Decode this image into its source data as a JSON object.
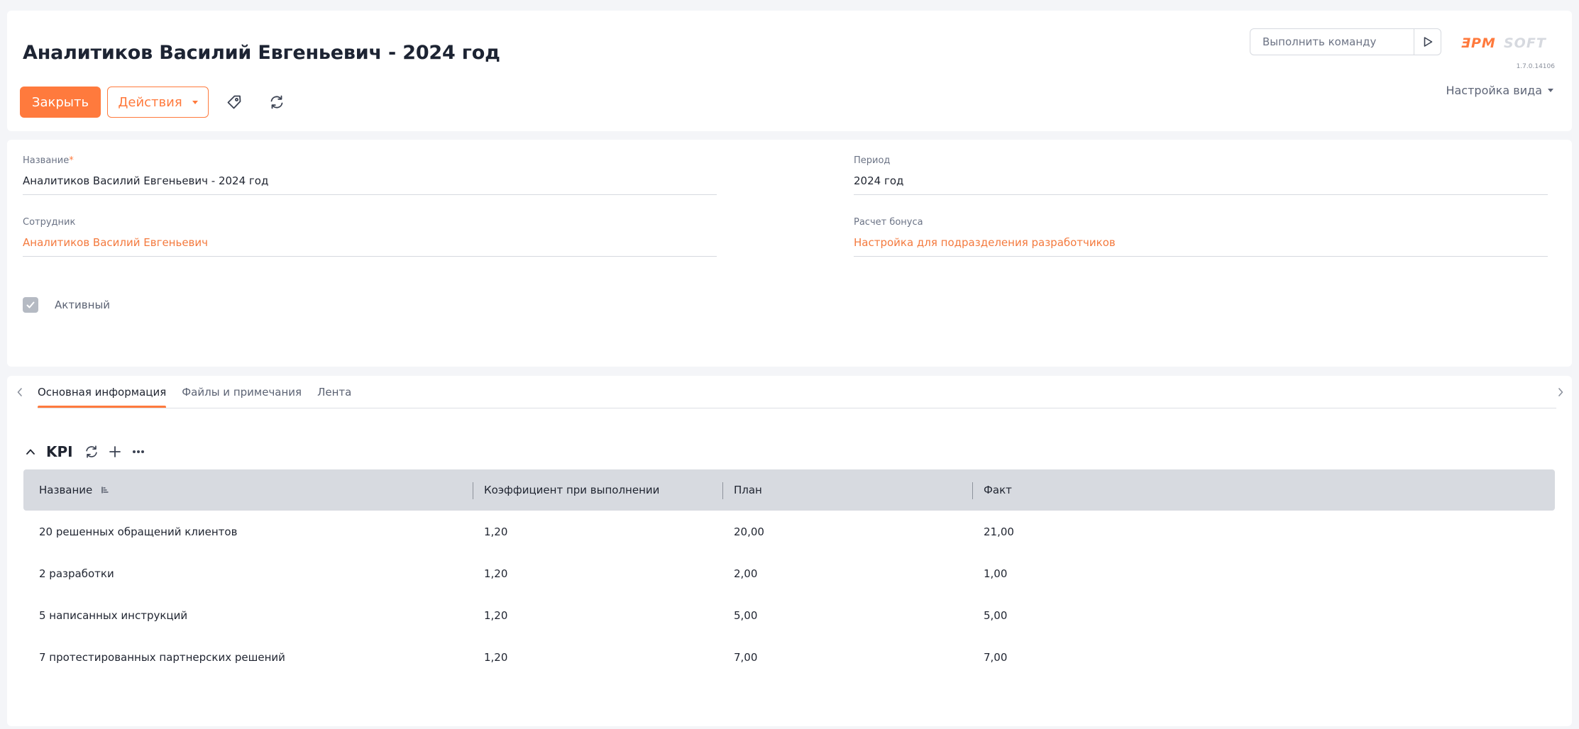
{
  "page": {
    "title": "Аналитиков Василий Евгеньевич - 2024 год"
  },
  "toolbar": {
    "close_label": "Закрыть",
    "actions_label": "Действия",
    "tag_icon": "tag-icon",
    "refresh_icon": "refresh-icon"
  },
  "command": {
    "placeholder": "Выполнить команду",
    "run_icon": "play-icon"
  },
  "brand": {
    "logo_text": "ƎPMSOFT",
    "version": "1.7.0.14106",
    "accent": "#ff7a3d"
  },
  "view_settings_label": "Настройка вида",
  "fields": {
    "name": {
      "label": "Название",
      "required_mark": "*",
      "value": "Аналитиков Василий Евгеньевич - 2024 год"
    },
    "period": {
      "label": "Период",
      "value": "2024 год"
    },
    "employee": {
      "label": "Сотрудник",
      "value": "Аналитиков Василий Евгеньевич"
    },
    "bonus_calc": {
      "label": "Расчет бонуса",
      "value": "Настройка для подразделения разработчиков"
    },
    "active": {
      "label": "Активный",
      "checked": true
    }
  },
  "tabs": [
    {
      "label": "Основная информация",
      "active": true
    },
    {
      "label": "Файлы и примечания",
      "active": false
    },
    {
      "label": "Лента",
      "active": false
    }
  ],
  "kpi": {
    "title": "KPI",
    "columns": [
      "Название",
      "Коэффициент при выполнении",
      "План",
      "Факт"
    ],
    "rows": [
      {
        "name": "20 решенных обращений клиентов",
        "coef": "1,20",
        "plan": "20,00",
        "fact": "21,00"
      },
      {
        "name": "2 разработки",
        "coef": "1,20",
        "plan": "2,00",
        "fact": "1,00"
      },
      {
        "name": "5 написанных инструкций",
        "coef": "1,20",
        "plan": "5,00",
        "fact": "5,00"
      },
      {
        "name": "7 протестированных партнерских решений",
        "coef": "1,20",
        "plan": "7,00",
        "fact": "7,00"
      }
    ]
  }
}
